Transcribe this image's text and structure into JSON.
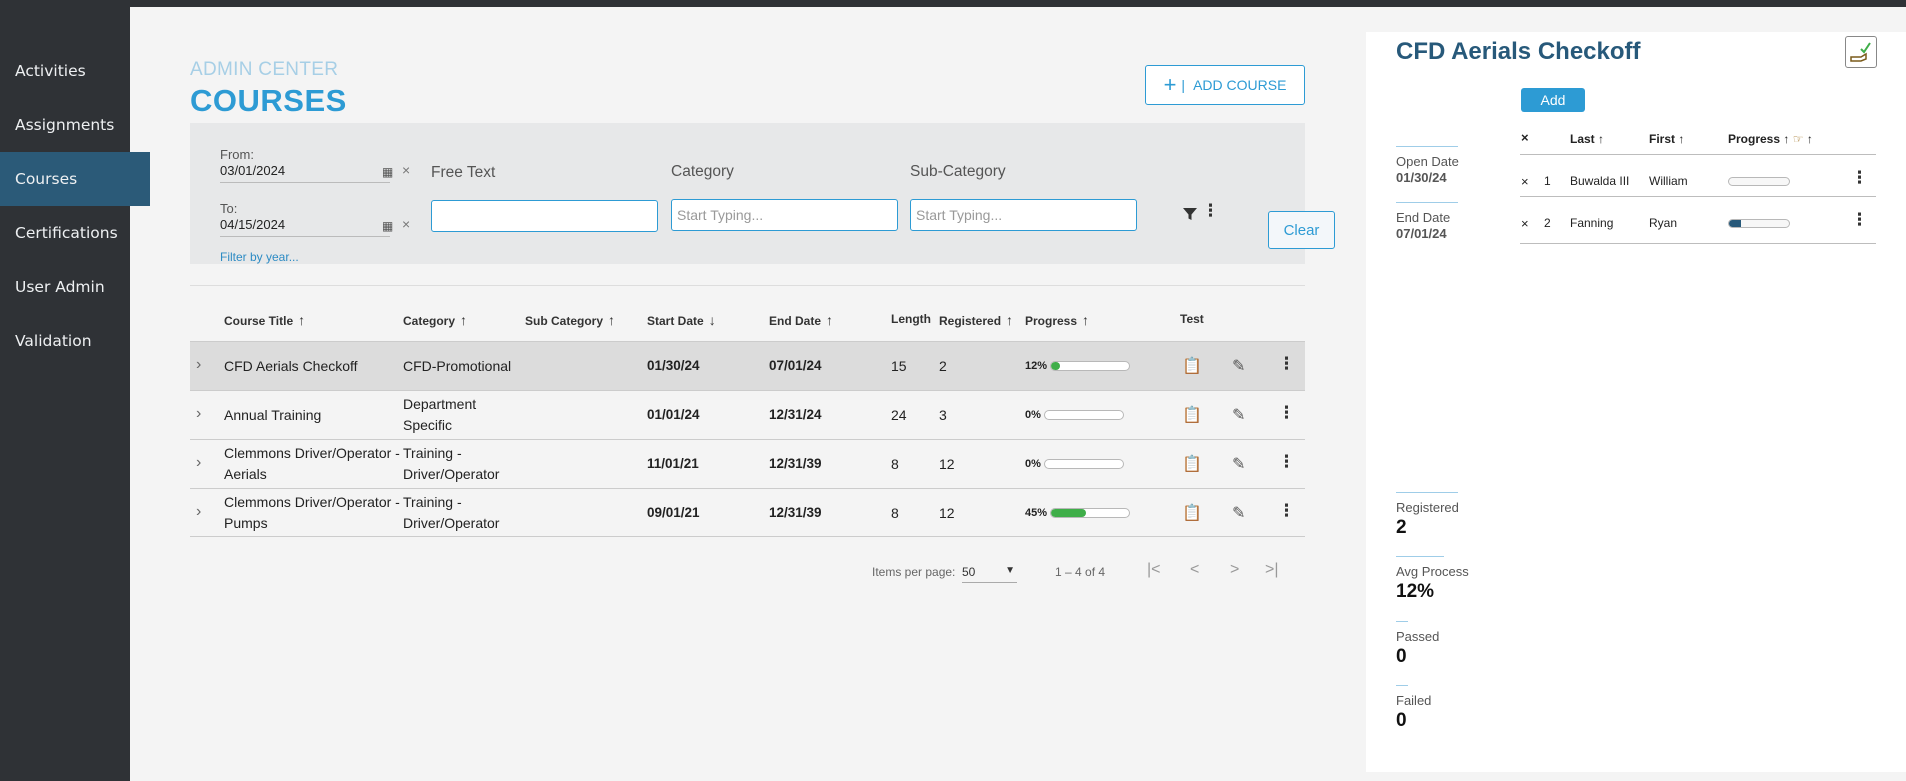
{
  "sidebar": {
    "items": [
      {
        "label": "Activities"
      },
      {
        "label": "Assignments"
      },
      {
        "label": "Courses"
      },
      {
        "label": "Certifications"
      },
      {
        "label": "User Admin"
      },
      {
        "label": "Validation"
      }
    ],
    "active_index": 2
  },
  "header": {
    "section": "ADMIN CENTER",
    "title": "COURSES",
    "add_course_label": "ADD COURSE",
    "add_course_separator": "|"
  },
  "filters": {
    "from_label": "From:",
    "from_value": "03/01/2024",
    "to_label": "To:",
    "to_value": "04/15/2024",
    "filter_by_year": "Filter by year...",
    "free_text_label": "Free Text",
    "free_text_value": "",
    "category_label": "Category",
    "category_placeholder": "Start Typing...",
    "subcategory_label": "Sub-Category",
    "subcategory_placeholder": "Start Typing...",
    "clear_label": "Clear"
  },
  "table": {
    "columns": [
      {
        "label": "Course Title",
        "sort": "↑"
      },
      {
        "label": "Category",
        "sort": "↑"
      },
      {
        "label": "Sub Category",
        "sort": "↑"
      },
      {
        "label": "Start Date",
        "sort": "↓"
      },
      {
        "label": "End Date",
        "sort": "↑"
      },
      {
        "label": "Length",
        "sort": ""
      },
      {
        "label": "Registered",
        "sort": "↑"
      },
      {
        "label": "Progress",
        "sort": "↑"
      },
      {
        "label": "Test",
        "sort": ""
      }
    ],
    "rows": [
      {
        "title": "CFD Aerials Checkoff",
        "category": "CFD-Promotional",
        "sub_category": "",
        "start": "01/30/24",
        "end": "07/01/24",
        "length": "15",
        "registered": "2",
        "progress_label": "12%",
        "progress": 0.12,
        "test_status": "clipboard-grey",
        "selected": true
      },
      {
        "title": "Annual Training",
        "category": "Department Specific",
        "sub_category": "",
        "start": "01/01/24",
        "end": "12/31/24",
        "length": "24",
        "registered": "3",
        "progress_label": "0%",
        "progress": 0.0,
        "test_status": "clipboard-grey",
        "selected": false
      },
      {
        "title": "Clemmons Driver/Operator - Aerials",
        "category": "Training - Driver/Operator",
        "sub_category": "",
        "start": "11/01/21",
        "end": "12/31/39",
        "length": "8",
        "registered": "12",
        "progress_label": "0%",
        "progress": 0.0,
        "test_status": "clipboard-grey",
        "selected": false
      },
      {
        "title": "Clemmons Driver/Operator - Pumps",
        "category": "Training - Driver/Operator",
        "sub_category": "",
        "start": "09/01/21",
        "end": "12/31/39",
        "length": "8",
        "registered": "12",
        "progress_label": "45%",
        "progress": 0.45,
        "test_status": "clipboard-green",
        "selected": false
      }
    ]
  },
  "pager": {
    "items_per_page_label": "Items per page:",
    "items_per_page": "50",
    "range": "1 – 4 of 4"
  },
  "detail": {
    "title": "CFD Aerials Checkoff",
    "add_label": "Add",
    "open_date_label": "Open Date",
    "open_date": "01/30/24",
    "end_date_label": "End Date",
    "end_date": "07/01/24",
    "columns": {
      "last": "Last",
      "first": "First",
      "progress": "Progress"
    },
    "participants": [
      {
        "num": "1",
        "last": "Buwalda III",
        "first": "William",
        "progress": 0.0
      },
      {
        "num": "2",
        "last": "Fanning",
        "first": "Ryan",
        "progress": 0.2
      }
    ],
    "stats": {
      "registered_label": "Registered",
      "registered": "2",
      "avg_label": "Avg Process",
      "avg": "12%",
      "passed_label": "Passed",
      "passed": "0",
      "failed_label": "Failed",
      "failed": "0"
    }
  },
  "colors": {
    "accent": "#2d9bd4",
    "sidebar_bg": "#2f3236",
    "sidebar_active": "#2b5a78",
    "progress_green": "#3fae49",
    "detail_title": "#27597a"
  }
}
